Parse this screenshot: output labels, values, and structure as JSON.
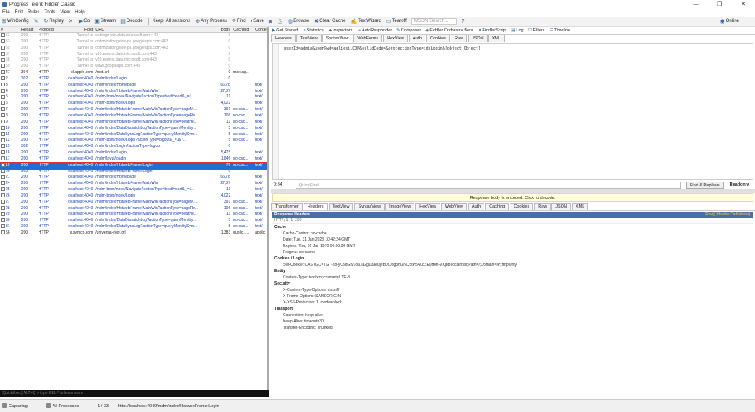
{
  "window": {
    "title": "Progress Telerik Fiddler Classic",
    "min": "—",
    "max": "❐",
    "close": "✕"
  },
  "menu": [
    "File",
    "Edit",
    "Rules",
    "Tools",
    "View",
    "Help"
  ],
  "toolbar": {
    "winconfig": "WinConfig",
    "replay": "Replay",
    "go": "Go",
    "stream": "Stream",
    "decode": "Decode",
    "keep": "Keep: All sessions",
    "any_process": "Any Process",
    "find": "Find",
    "save": "Save",
    "browse": "Browse",
    "clear_cache": "Clear Cache",
    "textwizard": "TextWizard",
    "tearoff": "Tearoff",
    "msdn_placeholder": "MSDN Search...",
    "online": "Online"
  },
  "sessions": {
    "columns": [
      "#",
      "Result",
      "Protocol",
      "Host",
      "URL",
      "Body",
      "Caching",
      "Conte"
    ],
    "rows": [
      [
        "52",
        "200",
        "HTTP",
        "Tunnel to",
        "settings-win.data.microsoft.com:443",
        "0",
        "",
        ""
      ],
      [
        "53",
        "200",
        "HTTP",
        "Tunnel to",
        "optimizationguide-pa.googleapis.com:443",
        "0",
        "",
        ""
      ],
      [
        "55",
        "200",
        "HTTP",
        "Tunnel to",
        "optimizationguide-pa.googleapis.com:443",
        "0",
        "",
        ""
      ],
      [
        "57",
        "200",
        "HTTP",
        "Tunnel to",
        "v10.events.data.microsoft.com:443",
        "0",
        "",
        ""
      ],
      [
        "58",
        "200",
        "HTTP",
        "Tunnel to",
        "v20.events.data.microsoft.com:443",
        "0",
        "",
        ""
      ],
      [
        "59",
        "200",
        "HTTP",
        "Tunnel to",
        "www.googleapis.com:443",
        "0",
        "",
        ""
      ],
      [
        "47",
        "304",
        "HTTP",
        "ol.apple.com",
        "/root.crl",
        "0",
        "max-ag...",
        ""
      ],
      [
        "2",
        "302",
        "HTTP",
        "localhost:4040",
        "/mdm/index/Login",
        "0",
        "",
        ""
      ],
      [
        "3",
        "200",
        "HTTP",
        "localhost:4040",
        "/mdm/index/Homepage",
        "66,787",
        "",
        "text/"
      ],
      [
        "4",
        "200",
        "HTTP",
        "localhost:4040",
        "/mdm/index/HotwebFrame.MainWin",
        "27,878",
        "",
        "text/"
      ],
      [
        "5",
        "200",
        "HTTP",
        "localhost:4040",
        "/mdm-bpm/index/Navigate?actionType=beatHeart&_=1...",
        "11",
        "",
        "text/"
      ],
      [
        "6",
        "200",
        "HTTP",
        "localhost:4040",
        "/mdm-bpm/index/Login",
        "4,022",
        "",
        "text/"
      ],
      [
        "7",
        "200",
        "HTTP",
        "localhost:4040",
        "/mdm/index/HotwebFrame.MainWin?actionType=pageM...",
        "391",
        "no-cac...",
        "text/"
      ],
      [
        "8",
        "200",
        "HTTP",
        "localhost:4040",
        "/mdm/index/HotwebFrame.MainWin?actionType=pageRe...",
        "106",
        "no-cac...",
        "text/"
      ],
      [
        "9",
        "200",
        "HTTP",
        "localhost:4040",
        "/mdm/index/HotwebFrame.MainWin?actionType=beatHe...",
        "11",
        "no-cac...",
        "text/"
      ],
      [
        "10",
        "200",
        "HTTP",
        "localhost:4040",
        "/mdm/index/DataDispatchLog?actionType=queryMentity...",
        "5",
        "no-cac...",
        "text/"
      ],
      [
        "11",
        "200",
        "HTTP",
        "localhost:4040",
        "/mdm/index/DataSyncLog?actionType=queryMentitySym...",
        "5",
        "no-cac...",
        "text/"
      ],
      [
        "12",
        "200",
        "HTTP",
        "localhost:4040",
        "/mdm-bpm/index/Login?actionType=logout&_=167...",
        "5",
        "no-cac...",
        "text/"
      ],
      [
        "15",
        "302",
        "HTTP",
        "localhost:4040",
        "/mdm/index/Login?actionType=logout",
        "0",
        "",
        ""
      ],
      [
        "16",
        "200",
        "HTTP",
        "localhost:4040",
        "/mdm/index/Login",
        "5,475",
        "",
        "text/"
      ],
      [
        "17",
        "200",
        "HTTP",
        "localhost:4040",
        "/mdm/layui/loadin",
        "1,846",
        "no-cac...",
        "text/"
      ],
      [
        "19",
        "200",
        "HTTP",
        "localhost:4040",
        "/mdm/index/HotwebFrame.Login",
        "76",
        "no-cac...",
        "text/"
      ],
      [
        "20",
        "302",
        "HTTP",
        "localhost:4040",
        "/mdm/index/HotwebFrame.Login",
        "0",
        "",
        ""
      ],
      [
        "21",
        "200",
        "HTTP",
        "localhost:4040",
        "/mdm/index/Homepage",
        "66,787",
        "",
        "text/"
      ],
      [
        "24",
        "200",
        "HTTP",
        "localhost:4040",
        "/mdm/index/HotwebFrame.MainWin",
        "27,878",
        "",
        "text/"
      ],
      [
        "25",
        "200",
        "HTTP",
        "localhost:4040",
        "/mdm-bpm/index/Navigate?actionType=beatHeart&_=1...",
        "11",
        "",
        "text/"
      ],
      [
        "26",
        "200",
        "HTTP",
        "localhost:4040",
        "/mdm-bpm/index/Login",
        "4,022",
        "",
        "text/"
      ],
      [
        "27",
        "200",
        "HTTP",
        "localhost:4040",
        "/mdm/index/HotwebFrame.MainWin?actionType=pageM...",
        "391",
        "no-cac...",
        "text/"
      ],
      [
        "28",
        "200",
        "HTTP",
        "localhost:4040",
        "/mdm/index/HotwebFrame.MainWin?actionType=pageRe...",
        "106",
        "no-cac...",
        "text/"
      ],
      [
        "29",
        "200",
        "HTTP",
        "localhost:4040",
        "/mdm/index/HotwebFrame.MainWin?actionType=beatHe...",
        "11",
        "no-cac...",
        "text/"
      ],
      [
        "30",
        "200",
        "HTTP",
        "localhost:4040",
        "/mdm/index/DataDispatchLog?actionType=queryMentity...",
        "5",
        "no-cac...",
        "text/"
      ],
      [
        "31",
        "200",
        "HTTP",
        "localhost:4040",
        "/mdm/index/DataSyncLog?actionType=queryMentitySym...",
        "5",
        "no-cac...",
        "text/"
      ],
      [
        "56",
        "200",
        "HTTP",
        "a.symcb.com",
        "/universal-root.crl",
        "1,383",
        "public, ...",
        "applic"
      ]
    ],
    "selected_index": 21
  },
  "quickexec": "[QuickExec] ALT+Q > type HELP to learn more",
  "inspector_top_tabs": [
    "Get Started",
    "Statistics",
    "Inspectors",
    "AutoResponder",
    "Composer",
    "Fiddler Orchestra Beta",
    "FiddlerScript",
    "Log",
    "Filters",
    "Timeline"
  ],
  "request_tabs": [
    "Headers",
    "TextView",
    "SyntaxView",
    "WebForms",
    "HexView",
    "Auth",
    "Cookies",
    "Raw",
    "JSON",
    "XML"
  ],
  "request_body": "userId=admin&userPwd=aqliesi.COM&validCode=&protectionType=idsLogin&[object Object]",
  "findbar": {
    "pos": "0:84",
    "placeholder": "QuickFind...",
    "button": "Find & Replace",
    "readonly": "Readonly"
  },
  "banner": "Response body is encoded. Click to decode.",
  "response_tabs": [
    "Transformer",
    "Headers",
    "TextView",
    "SyntaxView",
    "ImageView",
    "HexView",
    "WebView",
    "Auth",
    "Caching",
    "Cookies",
    "Raw",
    "JSON",
    "XML"
  ],
  "response": {
    "header": "Response Headers",
    "links": "[Raw]  [Header Definitions]",
    "status": "HTTP/1.1 200",
    "groups": [
      {
        "name": "Cache",
        "lines": [
          "Cache-Control: no-cache",
          "Date: Tue, 31 Jan 2023 10:42:24 GMT",
          "Expires: Thu, 01 Jan 1970 00:00:00 GMT",
          "Pragma: no-cache"
        ]
      },
      {
        "name": "Cookies / Login",
        "lines": [
          "Set-Cookie: CASTGC=TGT-28-yC5dGrv7oa.la2ga3aeujeB0xJpg3mZNC5tP5A0cZE0Hkn-VKjbb-localhost;Path=/;Domain=IP;HttpOnly"
        ]
      },
      {
        "name": "Entity",
        "lines": [
          "Content-Type: text/xml;charset=UTF-8"
        ]
      },
      {
        "name": "Security",
        "lines": [
          "X-Content-Type-Options: nosniff",
          "X-Frame-Options: SAMEORIGIN",
          "X-XSS-Protection: 1; mode=block"
        ]
      },
      {
        "name": "Transport",
        "lines": [
          "Connection: keep-alive",
          "Keep-Alive: timeout=30",
          "Transfer-Encoding: chunked"
        ]
      }
    ]
  },
  "statusbar": {
    "capturing": "Capturing",
    "processes": "All Processes",
    "count": "1 / 33",
    "url": "http://localhost:4040/mdm/index/HotwebFrame.Login"
  }
}
